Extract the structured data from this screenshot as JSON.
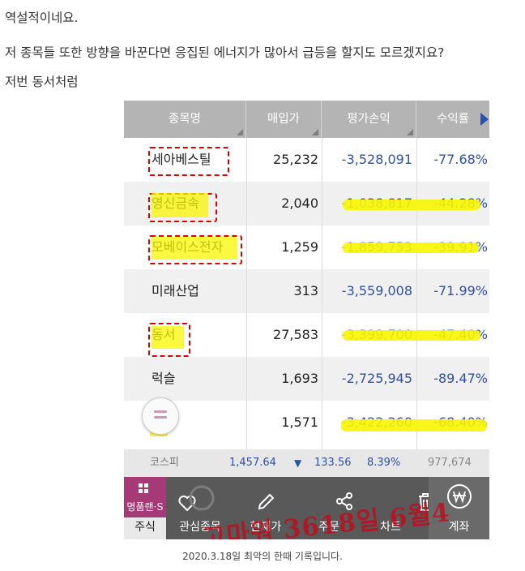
{
  "post": {
    "line1": "역설적이네요.",
    "line2": "저 종목들 또한 방향을 바꾼다면 응집된 에너지가 많아서 급등을 할지도 모르겠지요?",
    "line3": "저번 동서처럼"
  },
  "screenshot": {
    "table": {
      "headers": [
        "종목명",
        "매입가",
        "평가손익",
        "수익률"
      ],
      "rows": [
        {
          "name": "세아베스틸",
          "buy_price": "25,232",
          "pl": "-3,528,091",
          "rate": "-77.68%"
        },
        {
          "name": "영신금속",
          "buy_price": "2,040",
          "pl": "-1,038,817",
          "rate": "-44.28%"
        },
        {
          "name": "모베이스전자",
          "buy_price": "1,259",
          "pl": "-1,859,753",
          "rate": "-39.91%"
        },
        {
          "name": "미래산업",
          "buy_price": "313",
          "pl": "-3,559,008",
          "rate": "-71.99%"
        },
        {
          "name": "동서",
          "buy_price": "27,583",
          "pl": "-3,399,700",
          "rate": "-47.40%"
        },
        {
          "name": "럭슬",
          "buy_price": "1,693",
          "pl": "-2,725,945",
          "rate": "-89.47%"
        },
        {
          "name": "세동",
          "buy_price": "1,571",
          "pl": "-3,422,260",
          "rate": "-68.40%"
        }
      ]
    },
    "kospi_bar": {
      "label": "코스피",
      "index": "1,457.64",
      "change": "133.56",
      "change_pct": "8.39%",
      "volume": "977,674"
    },
    "tab_bar": {
      "brand": "명품랜·S",
      "tabs": [
        "주식",
        "관심종목",
        "현재가",
        "주문",
        "차트",
        "계좌"
      ]
    },
    "watermark": "고마워 3618일 6월4",
    "colors": {
      "header_bg": "#b4b4b4",
      "loss_text": "#2e4fa5",
      "brand": "#a63a77",
      "tab_bar": "#595959",
      "highlight": "#f8f500",
      "markup_red": "#e00000"
    }
  },
  "caption": "2020.3.18일 최악의 한때 기록입니다."
}
